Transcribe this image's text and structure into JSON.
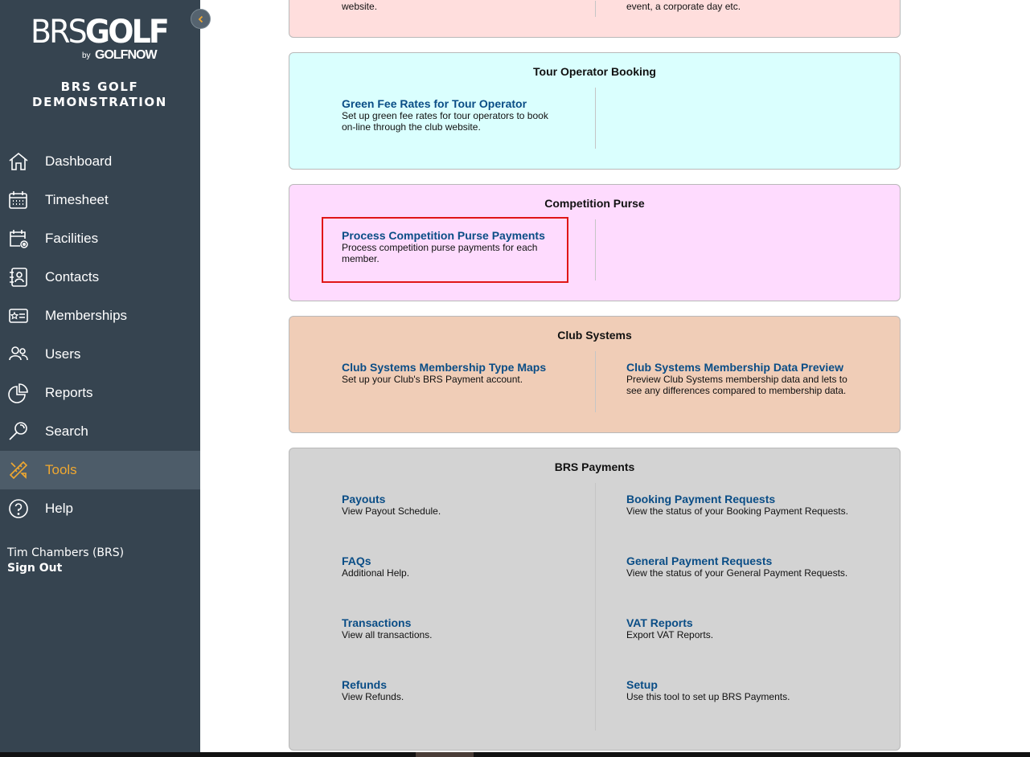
{
  "sidebar": {
    "logo_text": "BRSGOLF",
    "logo_by": "by",
    "logo_golfnow": "GOLFNOW",
    "club_name_line1": "BRS GOLF",
    "club_name_line2": "DEMONSTRATION",
    "nav": [
      {
        "label": "Dashboard",
        "icon": "home-icon"
      },
      {
        "label": "Timesheet",
        "icon": "calendar-icon"
      },
      {
        "label": "Facilities",
        "icon": "calendar-settings-icon"
      },
      {
        "label": "Contacts",
        "icon": "contacts-book-icon"
      },
      {
        "label": "Memberships",
        "icon": "membership-card-icon"
      },
      {
        "label": "Users",
        "icon": "users-icon"
      },
      {
        "label": "Reports",
        "icon": "pie-chart-icon"
      },
      {
        "label": "Search",
        "icon": "search-icon"
      },
      {
        "label": "Tools",
        "icon": "tools-icon",
        "active": true
      },
      {
        "label": "Help",
        "icon": "help-icon"
      }
    ],
    "user_name": "Tim Chambers (BRS)",
    "sign_out": "Sign Out"
  },
  "colors": {
    "sidebar_bg": "#364450",
    "active_nav": "#f0a830",
    "link": "#0a4d86",
    "event_card": "#ffdedd",
    "tour_card": "#dafffe",
    "competition_card": "#fedbfe",
    "club_systems_card": "#f0cdb7",
    "payments_card": "#d3d3d3"
  },
  "top_card": {
    "left_text": "website.",
    "right_text": "event, a corporate day etc."
  },
  "tour_card": {
    "title": "Tour Operator Booking",
    "tool": {
      "title": "Green Fee Rates for Tour Operator",
      "desc": "Set up green fee rates for tour operators to book on-line through the club website."
    }
  },
  "competition_card": {
    "title": "Competition Purse",
    "tool": {
      "title": "Process Competition Purse Payments",
      "desc": "Process competition purse payments for each member."
    }
  },
  "club_systems_card": {
    "title": "Club Systems",
    "left": {
      "title": "Club Systems Membership Type Maps",
      "desc": "Set up your Club's BRS Payment account."
    },
    "right": {
      "title": "Club Systems Membership Data Preview",
      "desc": "Preview Club Systems membership data and lets to see any differences compared to membership data."
    }
  },
  "payments_card": {
    "title": "BRS Payments",
    "left": [
      {
        "title": "Payouts",
        "desc": "View Payout Schedule."
      },
      {
        "title": "FAQs",
        "desc": "Additional Help."
      },
      {
        "title": "Transactions",
        "desc": "View all transactions."
      },
      {
        "title": "Refunds",
        "desc": "View Refunds."
      }
    ],
    "right": [
      {
        "title": "Booking Payment Requests",
        "desc": "View the status of your Booking Payment Requests."
      },
      {
        "title": "General Payment Requests",
        "desc": "View the status of your General Payment Requests."
      },
      {
        "title": "VAT Reports",
        "desc": "Export VAT Reports."
      },
      {
        "title": "Setup",
        "desc": "Use this tool to set up BRS Payments."
      }
    ]
  }
}
